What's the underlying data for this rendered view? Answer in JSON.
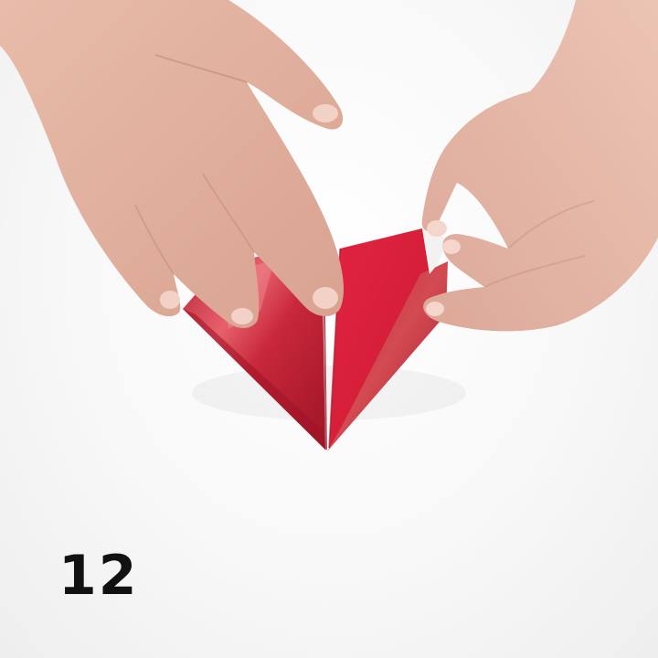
{
  "step": {
    "number": "12"
  },
  "colors": {
    "background": "#f8f8f8",
    "paper_red": "#d8203a",
    "paper_shiny": "#c8283a",
    "paper_white": "#f4f2f0",
    "skin": "#e2b2a0",
    "step_text": "#111111"
  },
  "icons": [
    "left-hand",
    "right-hand",
    "origami-paper"
  ]
}
